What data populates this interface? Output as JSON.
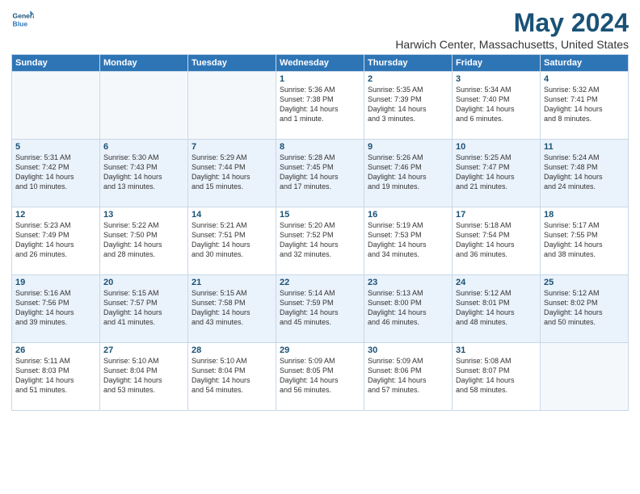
{
  "logo": {
    "line1": "General",
    "line2": "Blue"
  },
  "title": "May 2024",
  "location": "Harwich Center, Massachusetts, United States",
  "headers": [
    "Sunday",
    "Monday",
    "Tuesday",
    "Wednesday",
    "Thursday",
    "Friday",
    "Saturday"
  ],
  "weeks": [
    [
      {
        "day": "",
        "text": ""
      },
      {
        "day": "",
        "text": ""
      },
      {
        "day": "",
        "text": ""
      },
      {
        "day": "1",
        "text": "Sunrise: 5:36 AM\nSunset: 7:38 PM\nDaylight: 14 hours\nand 1 minute."
      },
      {
        "day": "2",
        "text": "Sunrise: 5:35 AM\nSunset: 7:39 PM\nDaylight: 14 hours\nand 3 minutes."
      },
      {
        "day": "3",
        "text": "Sunrise: 5:34 AM\nSunset: 7:40 PM\nDaylight: 14 hours\nand 6 minutes."
      },
      {
        "day": "4",
        "text": "Sunrise: 5:32 AM\nSunset: 7:41 PM\nDaylight: 14 hours\nand 8 minutes."
      }
    ],
    [
      {
        "day": "5",
        "text": "Sunrise: 5:31 AM\nSunset: 7:42 PM\nDaylight: 14 hours\nand 10 minutes."
      },
      {
        "day": "6",
        "text": "Sunrise: 5:30 AM\nSunset: 7:43 PM\nDaylight: 14 hours\nand 13 minutes."
      },
      {
        "day": "7",
        "text": "Sunrise: 5:29 AM\nSunset: 7:44 PM\nDaylight: 14 hours\nand 15 minutes."
      },
      {
        "day": "8",
        "text": "Sunrise: 5:28 AM\nSunset: 7:45 PM\nDaylight: 14 hours\nand 17 minutes."
      },
      {
        "day": "9",
        "text": "Sunrise: 5:26 AM\nSunset: 7:46 PM\nDaylight: 14 hours\nand 19 minutes."
      },
      {
        "day": "10",
        "text": "Sunrise: 5:25 AM\nSunset: 7:47 PM\nDaylight: 14 hours\nand 21 minutes."
      },
      {
        "day": "11",
        "text": "Sunrise: 5:24 AM\nSunset: 7:48 PM\nDaylight: 14 hours\nand 24 minutes."
      }
    ],
    [
      {
        "day": "12",
        "text": "Sunrise: 5:23 AM\nSunset: 7:49 PM\nDaylight: 14 hours\nand 26 minutes."
      },
      {
        "day": "13",
        "text": "Sunrise: 5:22 AM\nSunset: 7:50 PM\nDaylight: 14 hours\nand 28 minutes."
      },
      {
        "day": "14",
        "text": "Sunrise: 5:21 AM\nSunset: 7:51 PM\nDaylight: 14 hours\nand 30 minutes."
      },
      {
        "day": "15",
        "text": "Sunrise: 5:20 AM\nSunset: 7:52 PM\nDaylight: 14 hours\nand 32 minutes."
      },
      {
        "day": "16",
        "text": "Sunrise: 5:19 AM\nSunset: 7:53 PM\nDaylight: 14 hours\nand 34 minutes."
      },
      {
        "day": "17",
        "text": "Sunrise: 5:18 AM\nSunset: 7:54 PM\nDaylight: 14 hours\nand 36 minutes."
      },
      {
        "day": "18",
        "text": "Sunrise: 5:17 AM\nSunset: 7:55 PM\nDaylight: 14 hours\nand 38 minutes."
      }
    ],
    [
      {
        "day": "19",
        "text": "Sunrise: 5:16 AM\nSunset: 7:56 PM\nDaylight: 14 hours\nand 39 minutes."
      },
      {
        "day": "20",
        "text": "Sunrise: 5:15 AM\nSunset: 7:57 PM\nDaylight: 14 hours\nand 41 minutes."
      },
      {
        "day": "21",
        "text": "Sunrise: 5:15 AM\nSunset: 7:58 PM\nDaylight: 14 hours\nand 43 minutes."
      },
      {
        "day": "22",
        "text": "Sunrise: 5:14 AM\nSunset: 7:59 PM\nDaylight: 14 hours\nand 45 minutes."
      },
      {
        "day": "23",
        "text": "Sunrise: 5:13 AM\nSunset: 8:00 PM\nDaylight: 14 hours\nand 46 minutes."
      },
      {
        "day": "24",
        "text": "Sunrise: 5:12 AM\nSunset: 8:01 PM\nDaylight: 14 hours\nand 48 minutes."
      },
      {
        "day": "25",
        "text": "Sunrise: 5:12 AM\nSunset: 8:02 PM\nDaylight: 14 hours\nand 50 minutes."
      }
    ],
    [
      {
        "day": "26",
        "text": "Sunrise: 5:11 AM\nSunset: 8:03 PM\nDaylight: 14 hours\nand 51 minutes."
      },
      {
        "day": "27",
        "text": "Sunrise: 5:10 AM\nSunset: 8:04 PM\nDaylight: 14 hours\nand 53 minutes."
      },
      {
        "day": "28",
        "text": "Sunrise: 5:10 AM\nSunset: 8:04 PM\nDaylight: 14 hours\nand 54 minutes."
      },
      {
        "day": "29",
        "text": "Sunrise: 5:09 AM\nSunset: 8:05 PM\nDaylight: 14 hours\nand 56 minutes."
      },
      {
        "day": "30",
        "text": "Sunrise: 5:09 AM\nSunset: 8:06 PM\nDaylight: 14 hours\nand 57 minutes."
      },
      {
        "day": "31",
        "text": "Sunrise: 5:08 AM\nSunset: 8:07 PM\nDaylight: 14 hours\nand 58 minutes."
      },
      {
        "day": "",
        "text": ""
      }
    ]
  ]
}
